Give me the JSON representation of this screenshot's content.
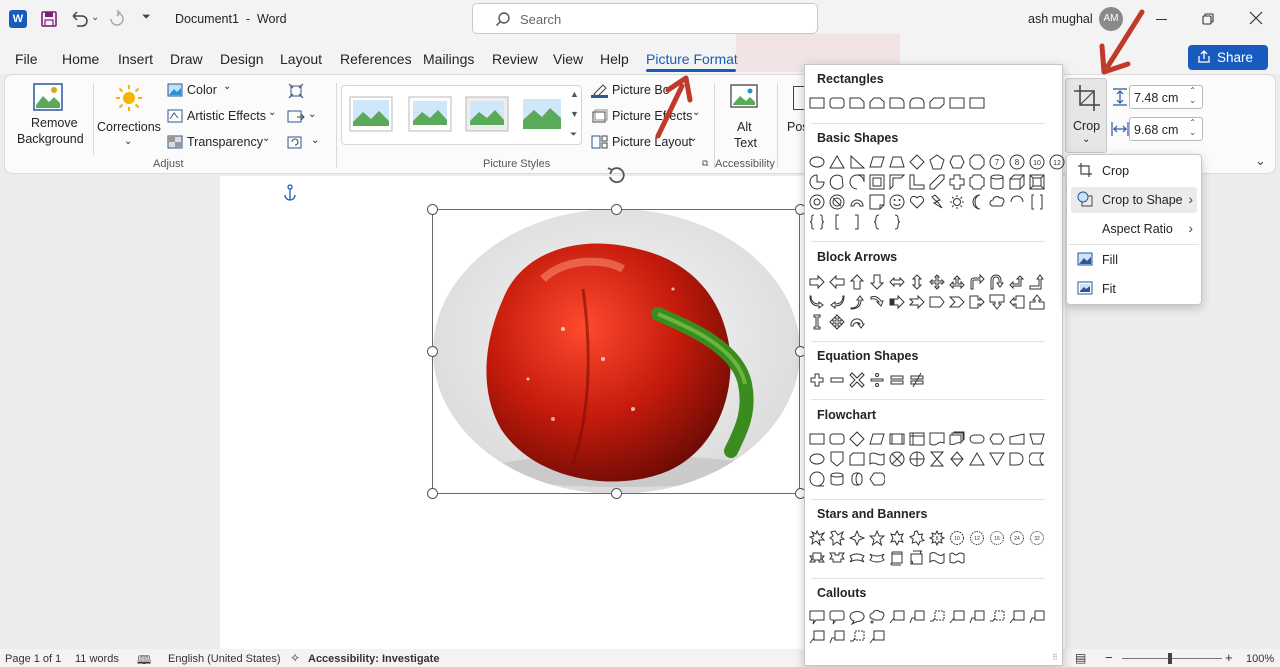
{
  "title_bar": {
    "document_title": "Document1  -  Word",
    "search_placeholder": "Search",
    "user_name": "ash mughal",
    "user_initials": "AM",
    "share_label": "Share"
  },
  "tabs": [
    "File",
    "Home",
    "Insert",
    "Draw",
    "Design",
    "Layout",
    "References",
    "Mailings",
    "Review",
    "View",
    "Help",
    "Picture Format"
  ],
  "active_tab": "Picture Format",
  "ribbon": {
    "remove_background": "Remove Background",
    "remove_background_l1": "Remove",
    "remove_background_l2": "Background",
    "corrections": "Corrections",
    "color": "Color",
    "artistic_effects": "Artistic Effects",
    "transparency": "Transparency",
    "adjust_group": "Adjust",
    "picture_styles_group": "Picture Styles",
    "picture_border": "Picture Bo",
    "picture_effects": "Picture Effects",
    "picture_layout": "Picture Layout",
    "alt_text_l1": "Alt",
    "alt_text_l2": "Text",
    "accessibility_group": "Accessibility",
    "position_partial": "Pos",
    "crop": "Crop",
    "height": "7.48 cm",
    "width": "9.68 cm"
  },
  "shapes_gallery": {
    "sections": [
      "Rectangles",
      "Basic Shapes",
      "Block Arrows",
      "Equation Shapes",
      "Flowchart",
      "Stars and Banners",
      "Callouts"
    ]
  },
  "crop_menu": {
    "items": [
      "Crop",
      "Crop to Shape",
      "Aspect Ratio",
      "Fill",
      "Fit"
    ]
  },
  "status_bar": {
    "page": "Page 1 of 1",
    "words": "11 words",
    "language": "English (United States)",
    "accessibility": "Accessibility: Investigate",
    "zoom": "100%"
  },
  "colors": {
    "accent": "#185abd",
    "word_blue": "#2b579a",
    "arrow_red": "#c0392b"
  }
}
